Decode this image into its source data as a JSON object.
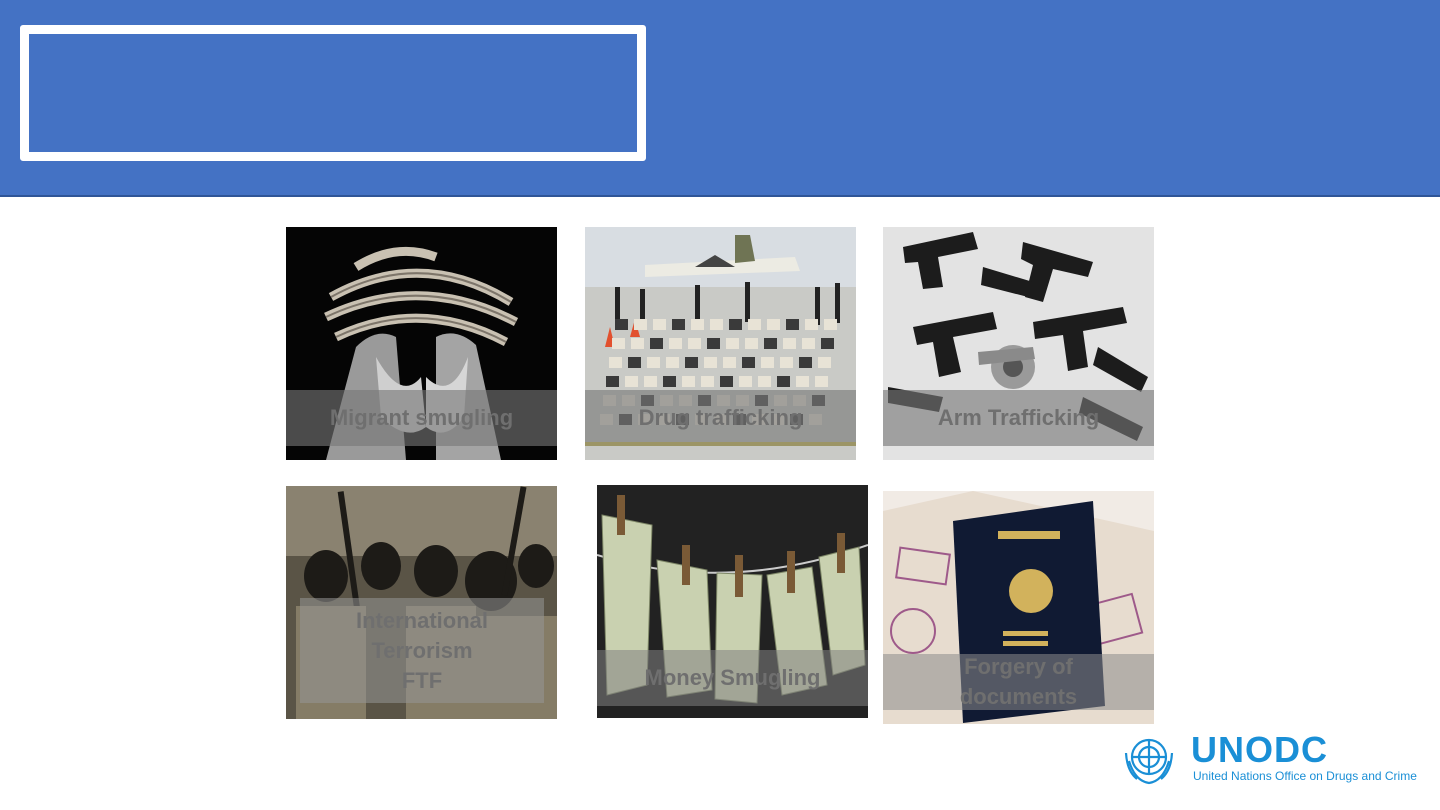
{
  "slide": {
    "title": "",
    "header_color": "#4472c4"
  },
  "tiles": [
    {
      "caption": "Migrant smugling",
      "image": "bound-hands-photo"
    },
    {
      "caption": "Drug trafficking",
      "image": "seized-drugs-airfield-photo"
    },
    {
      "caption": "Arm Trafficking",
      "image": "handguns-pile-photo"
    },
    {
      "caption_lines": [
        "International",
        "Terrorism",
        "FTF"
      ],
      "image": "armed-militants-photo"
    },
    {
      "caption": "Money Smugling",
      "image": "banknotes-clothesline-photo"
    },
    {
      "caption_lines": [
        "Forgery of",
        "documents"
      ],
      "image": "passport-photo"
    }
  ],
  "logo": {
    "wordmark": "UNODC",
    "subtitle": "United Nations Office on Drugs and Crime",
    "color": "#1a8fd6"
  }
}
